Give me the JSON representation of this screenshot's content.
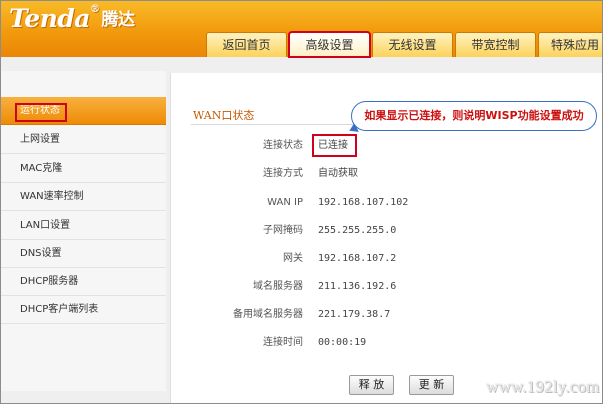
{
  "header": {
    "logo_text": "Tenda",
    "logo_reg": "®",
    "logo_cn": "腾达"
  },
  "nav": {
    "tabs": [
      {
        "label": "返回首页"
      },
      {
        "label": "高级设置"
      },
      {
        "label": "无线设置"
      },
      {
        "label": "带宽控制"
      },
      {
        "label": "特殊应用"
      }
    ],
    "active_index": 1
  },
  "sidebar": {
    "items": [
      {
        "label": "运行状态"
      },
      {
        "label": "上网设置"
      },
      {
        "label": "MAC克隆"
      },
      {
        "label": "WAN速率控制"
      },
      {
        "label": "LAN口设置"
      },
      {
        "label": "DNS设置"
      },
      {
        "label": "DHCP服务器"
      },
      {
        "label": "DHCP客户端列表"
      }
    ],
    "active_index": 0
  },
  "main": {
    "section_title": "WAN口状态",
    "callout": "如果显示已连接，则说明WISP功能设置成功",
    "rows": [
      {
        "label": "连接状态",
        "value": "已连接"
      },
      {
        "label": "连接方式",
        "value": "自动获取"
      },
      {
        "label": "WAN IP",
        "value": "192.168.107.102"
      },
      {
        "label": "子网掩码",
        "value": "255.255.255.0"
      },
      {
        "label": "网关",
        "value": "192.168.107.2"
      },
      {
        "label": "域名服务器",
        "value": "211.136.192.6"
      },
      {
        "label": "备用域名服务器",
        "value": "221.179.38.7"
      },
      {
        "label": "连接时间",
        "value": "00:00:19"
      }
    ],
    "buttons": {
      "release": "释 放",
      "refresh": "更 新"
    }
  },
  "watermark": "www.192ly.com",
  "colors": {
    "header_orange": "#f29a0e",
    "highlight_red": "#d0021b",
    "callout_blue": "#3a6fc7",
    "callout_text": "#cc1010"
  }
}
